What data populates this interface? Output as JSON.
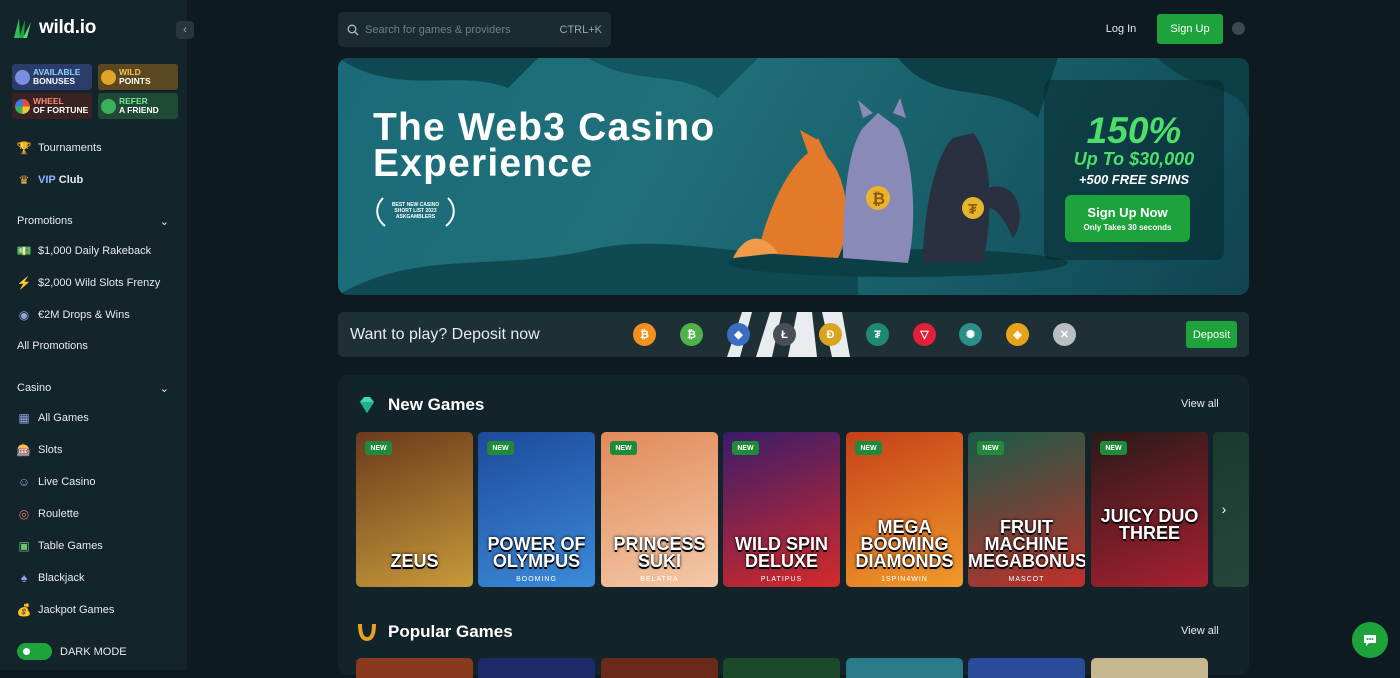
{
  "brand": {
    "logo_text": "wild.io"
  },
  "sidebar": {
    "promo_tiles": [
      {
        "line1": "AVAILABLE",
        "line2": "BONUSES",
        "icon": "bonus-icon",
        "bg": "#2b3c6a"
      },
      {
        "line1": "WILD",
        "line2": "POINTS",
        "icon": "points-icon",
        "bg": "#5c4820"
      },
      {
        "line1": "WHEEL",
        "line2": "OF FORTUNE",
        "icon": "wheel-icon",
        "bg": "#5a2a2a"
      },
      {
        "line1": "REFER",
        "line2": "A FRIEND",
        "icon": "refer-icon",
        "bg": "#1f4a35"
      }
    ],
    "top_items": [
      {
        "label": "Tournaments",
        "icon": "trophy-icon"
      },
      {
        "label_accent": "VIP",
        "label": "Club",
        "icon": "crown-icon"
      }
    ],
    "promotions": {
      "header": "Promotions",
      "items": [
        {
          "label": "$1,000 Daily Rakeback",
          "icon": "cash-icon"
        },
        {
          "label": "$2,000 Wild Slots Frenzy",
          "icon": "slots-frenzy-icon"
        },
        {
          "label": "€2M Drops & Wins",
          "icon": "drops-icon"
        }
      ],
      "all_label": "All Promotions"
    },
    "casino": {
      "header": "Casino",
      "items": [
        {
          "label": "All Games",
          "icon": "grid-icon"
        },
        {
          "label": "Slots",
          "icon": "slot-machine-icon"
        },
        {
          "label": "Live Casino",
          "icon": "dealer-icon"
        },
        {
          "label": "Roulette",
          "icon": "roulette-icon"
        },
        {
          "label": "Table Games",
          "icon": "table-icon"
        },
        {
          "label": "Blackjack",
          "icon": "cards-icon"
        },
        {
          "label": "Jackpot Games",
          "icon": "moneybag-icon"
        }
      ]
    },
    "dark_mode_label": "DARK MODE",
    "dark_mode_on": true
  },
  "header": {
    "search_placeholder": "Search for games & providers",
    "search_shortcut": "CTRL+K",
    "login_label": "Log In",
    "signup_label": "Sign Up"
  },
  "banner": {
    "title_line1": "The Web3 Casino",
    "title_line2": "Experience",
    "award_text": "BEST NEW CASINO SHORT LIST 2023 ASKGAMBLERS",
    "offer_percent": "150%",
    "offer_amount": "Up To $30,000",
    "offer_spins": "+500 FREE SPINS",
    "cta_label": "Sign Up Now",
    "cta_sub": "Only Takes 30 seconds"
  },
  "deposit_bar": {
    "label": "Want to play? Deposit now",
    "button_label": "Deposit",
    "coins": [
      {
        "name": "bitcoin-icon",
        "glyph": "₿",
        "color": "#f2901c"
      },
      {
        "name": "bitcoin-cash-icon",
        "glyph": "₿",
        "color": "#4fb34a"
      },
      {
        "name": "ethereum-icon",
        "glyph": "◆",
        "color": "#3b6ec2"
      },
      {
        "name": "litecoin-icon",
        "glyph": "Ł",
        "color": "#4a4f57"
      },
      {
        "name": "dogecoin-icon",
        "glyph": "Ð",
        "color": "#d9a520"
      },
      {
        "name": "tether-icon",
        "glyph": "₮",
        "color": "#1f8a72"
      },
      {
        "name": "tron-icon",
        "glyph": "▽",
        "color": "#e3203c"
      },
      {
        "name": "ripple-icon",
        "glyph": "✺",
        "color": "#2a8f86"
      },
      {
        "name": "bnb-icon",
        "glyph": "◈",
        "color": "#e8a31c"
      },
      {
        "name": "xrp-icon",
        "glyph": "✕",
        "color": "#b9bec2"
      }
    ]
  },
  "new_games": {
    "title": "New Games",
    "view_all": "View all",
    "badge": "NEW",
    "cards": [
      {
        "name": "ZEUS",
        "provider": "",
        "bg": "#6b3a1c",
        "bg2": "#c79a3a"
      },
      {
        "name": "POWER OF OLYMPUS",
        "provider": "BOOMING",
        "bg": "#1e4a9a",
        "bg2": "#3b8bd9"
      },
      {
        "name": "PRINCESS SUKI",
        "provider": "BELATRA",
        "bg": "#e28a5a",
        "bg2": "#f3c9a8"
      },
      {
        "name": "WILD SPIN DELUXE",
        "provider": "PLATIPUS",
        "bg": "#3a1c6a",
        "bg2": "#d42a2a"
      },
      {
        "name": "MEGA BOOMING DIAMONDS",
        "provider": "1SPIN4WIN",
        "bg": "#c5401a",
        "bg2": "#f09a2a"
      },
      {
        "name": "FRUIT MACHINE MEGABONUS",
        "provider": "MASCOT",
        "bg": "#1a5a48",
        "bg2": "#c0302a"
      },
      {
        "name": "JUICY DUO THREE",
        "provider": "",
        "bg": "#2a1a1a",
        "bg2": "#a82030"
      },
      {
        "name": "",
        "provider": "",
        "bg": "#1a3a30",
        "bg2": "#26453b"
      }
    ]
  },
  "popular_games": {
    "title": "Popular Games",
    "view_all": "View all",
    "thumb_colors": [
      "#8a3a1c",
      "#1a2a6a",
      "#6a2a1a",
      "#1a4a2a",
      "#2a7a8a",
      "#2a4a9a",
      "#c8b890"
    ]
  }
}
